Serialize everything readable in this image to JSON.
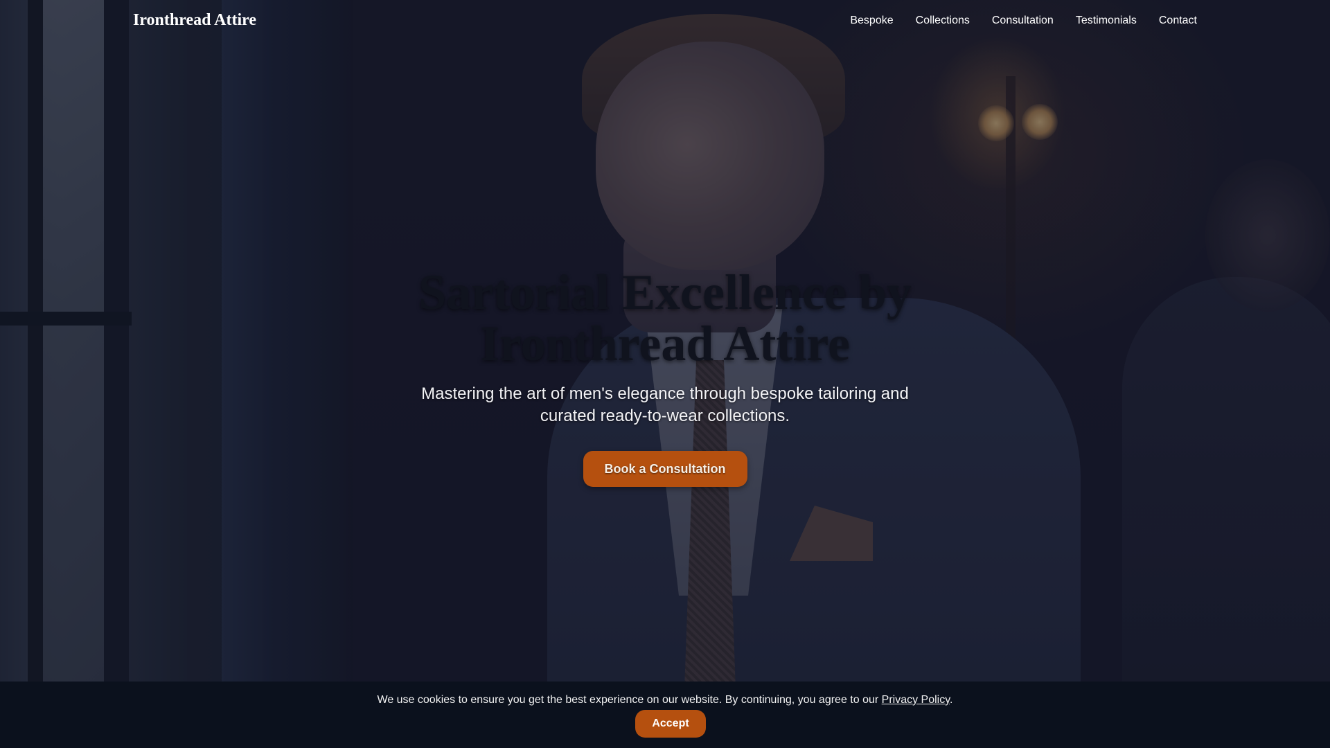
{
  "header": {
    "brand": "Ironthread Attire",
    "nav": [
      {
        "label": "Bespoke"
      },
      {
        "label": "Collections"
      },
      {
        "label": "Consultation"
      },
      {
        "label": "Testimonials"
      },
      {
        "label": "Contact"
      }
    ]
  },
  "hero": {
    "title": "Sartorial Excellence by Ironthread Attire",
    "subtitle": "Mastering the art of men's elegance through bespoke tailoring and curated ready-to-wear collections.",
    "cta_label": "Book a Consultation"
  },
  "cookie_banner": {
    "text_before": "We use cookies to ensure you get the best experience on our website. By continuing, you agree to our ",
    "link_label": "Privacy Policy",
    "text_after": ".",
    "accept_label": "Accept"
  },
  "colors": {
    "accent": "#b5500f",
    "banner_bg": "#0b111d",
    "title_text": "#10131e"
  }
}
